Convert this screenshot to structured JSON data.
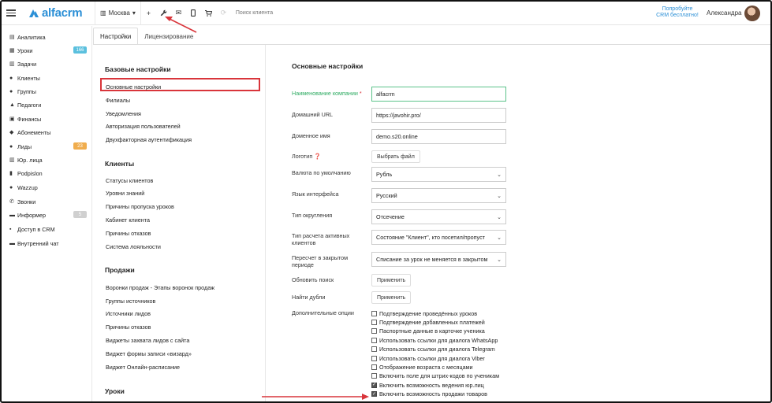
{
  "app": {
    "logo_text": "alfacrm",
    "brand_color": "#2b8fd6"
  },
  "topbar": {
    "city": "Москва",
    "buttons": [
      {
        "name": "add",
        "glyph": "+"
      },
      {
        "name": "wrench",
        "glyph": "🔧"
      },
      {
        "name": "mail",
        "glyph": "✉"
      },
      {
        "name": "phone",
        "glyph": "▯"
      },
      {
        "name": "cart",
        "glyph": "🛒"
      },
      {
        "name": "spinner",
        "glyph": "⟳"
      }
    ],
    "search_placeholder": "Поиск клиента",
    "promo_line1": "Попробуйте",
    "promo_line2": "CRM бесплатно!",
    "user_name": "Александра"
  },
  "sidebar": {
    "items": [
      {
        "label": "Аналитика",
        "icon": "chart-icon",
        "glyph": "▤"
      },
      {
        "label": "Уроки",
        "icon": "calendar-icon",
        "glyph": "▦",
        "badge": "166",
        "badge_color": "#5bc0de"
      },
      {
        "label": "Задачи",
        "icon": "tasks-icon",
        "glyph": "▥"
      },
      {
        "label": "Клиенты",
        "icon": "user-icon",
        "glyph": "●"
      },
      {
        "label": "Группы",
        "icon": "group-icon",
        "glyph": "●"
      },
      {
        "label": "Педагоги",
        "icon": "graduation-icon",
        "glyph": "▲"
      },
      {
        "label": "Финансы",
        "icon": "money-icon",
        "glyph": "▣"
      },
      {
        "label": "Абонементы",
        "icon": "tag-icon",
        "glyph": "◆"
      },
      {
        "label": "Лиды",
        "icon": "user-plus-icon",
        "glyph": "●",
        "badge": "23",
        "badge_color": "#f0ad4e"
      },
      {
        "label": "Юр. лица",
        "icon": "building-icon",
        "glyph": "▥"
      },
      {
        "label": "Podpislon",
        "icon": "document-icon",
        "glyph": "▮"
      },
      {
        "label": "Wazzup",
        "icon": "chat-bubble-icon",
        "glyph": "●"
      },
      {
        "label": "Звонки",
        "icon": "phone-icon",
        "glyph": "✆"
      },
      {
        "label": "Информер",
        "icon": "window-icon",
        "glyph": "▬",
        "badge": "5",
        "badge_color": "#d0d0d0"
      },
      {
        "label": "Доступ в CRM",
        "icon": "lock-icon",
        "glyph": "▪"
      },
      {
        "label": "Внутренний чат",
        "icon": "chat-icon",
        "glyph": "▬"
      }
    ]
  },
  "tabs": [
    {
      "label": "Настройки"
    },
    {
      "label": "Лицензирование"
    }
  ],
  "menu": {
    "sections": [
      {
        "title": "Базовые настройки",
        "items": [
          "Основные настройки",
          "Филиалы",
          "Уведомления",
          "Авторизация пользователей",
          "Двухфакторная аутентификация"
        ]
      },
      {
        "title": "Клиенты",
        "items": [
          "Статусы клиентов",
          "Уровни знаний",
          "Причины пропуска уроков",
          "Кабинет клиента",
          "Причины отказов",
          "Система лояльности"
        ]
      },
      {
        "title": "Продажи",
        "items": [
          "Воронки продаж - Этапы воронок продаж",
          "Группы источников",
          "Источники лидов",
          "Причины отказов",
          "Виджеты захвата лидов с сайта",
          "Виджет формы записи «визард»",
          "Виджет Онлайн-расписание"
        ]
      },
      {
        "title": "Уроки",
        "items": []
      }
    ]
  },
  "content": {
    "title": "Основные настройки",
    "company_label": "Наименование компании",
    "company_value": "alfacrm",
    "home_url_label": "Домашний URL",
    "home_url_value": "https://javohir.pro/",
    "domain_label": "Доменное имя",
    "domain_value": "demo.s20.online",
    "logo_label": "Логотип",
    "logo_button": "Выбрать файл",
    "currency_label": "Валюта по умолчанию",
    "currency_value": "Рубль",
    "language_label": "Язык интерфейса",
    "language_value": "Русский",
    "rounding_label": "Тип округления",
    "rounding_value": "Отсечение",
    "active_calc_label": "Тип расчета активных клиентов",
    "active_calc_value": "Состояние \"Клиент\", кто посетил/пропуст",
    "recalc_label": "Пересчет в закрытом периоде",
    "recalc_value": "Списание за урок не меняется в закрытом",
    "reindex_label": "Обновить поиск",
    "reindex_button": "Применить",
    "dupes_label": "Найти дубли",
    "dupes_button": "Применить",
    "options_label": "Дополнительные опции",
    "options": [
      {
        "label": "Подтверждение проведённых уроков",
        "checked": false
      },
      {
        "label": "Подтверждение добавленных платежей",
        "checked": false
      },
      {
        "label": "Паспортные данные в карточке ученика",
        "checked": false
      },
      {
        "label": "Использовать ссылки для диалога WhatsApp",
        "checked": false
      },
      {
        "label": "Использовать ссылки для диалога Telegram",
        "checked": false
      },
      {
        "label": "Использовать ссылки для диалога Viber",
        "checked": false
      },
      {
        "label": "Отображение возраста с месяцами",
        "checked": false
      },
      {
        "label": "Включить поле для штрих-кодов по ученикам",
        "checked": false
      },
      {
        "label": "Включить возможность ведения юр.лиц",
        "checked": true
      },
      {
        "label": "Включить возможность продажи товаров",
        "checked": true
      }
    ]
  },
  "annotations": {
    "arrow_color": "#d9353b"
  }
}
